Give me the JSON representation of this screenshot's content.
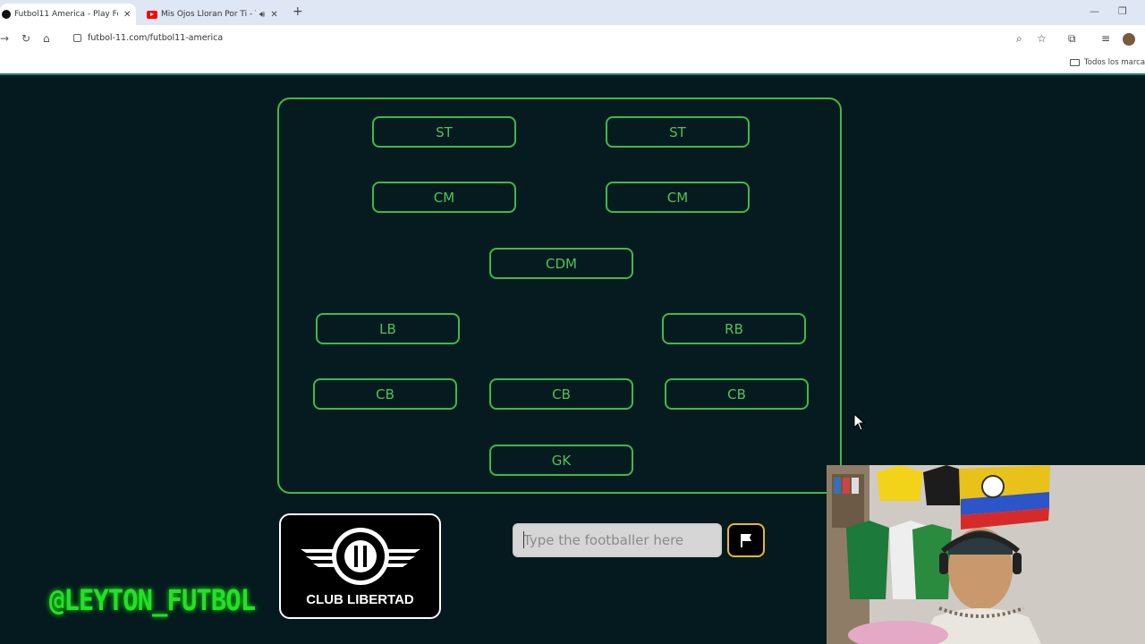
{
  "browser": {
    "tabs": [
      {
        "title": "Futbol11 America - Play Footba",
        "active": true
      },
      {
        "title": "Mis Ojos Lloran Por Ti - You",
        "active": false
      }
    ],
    "url": "futbol-11.com/futbol11-america",
    "bookmarks_label": "Todos los marcad"
  },
  "pitch": {
    "positions": [
      {
        "label": "ST"
      },
      {
        "label": "ST"
      },
      {
        "label": "CM"
      },
      {
        "label": "CM"
      },
      {
        "label": "CDM"
      },
      {
        "label": "LB"
      },
      {
        "label": "RB"
      },
      {
        "label": "CB"
      },
      {
        "label": "CB"
      },
      {
        "label": "CB"
      },
      {
        "label": "GK"
      }
    ]
  },
  "club": {
    "name": "CLUB LIBERTAD",
    "logo_text": "CLUB LIBERTAD"
  },
  "guess": {
    "placeholder": "Type the footballer here",
    "value": ""
  },
  "overlay": {
    "handle": "@LEYTON_FUTBOL"
  },
  "colors": {
    "accent": "#3fb94a",
    "background": "#051a1f",
    "flag_border": "#e8b923"
  }
}
